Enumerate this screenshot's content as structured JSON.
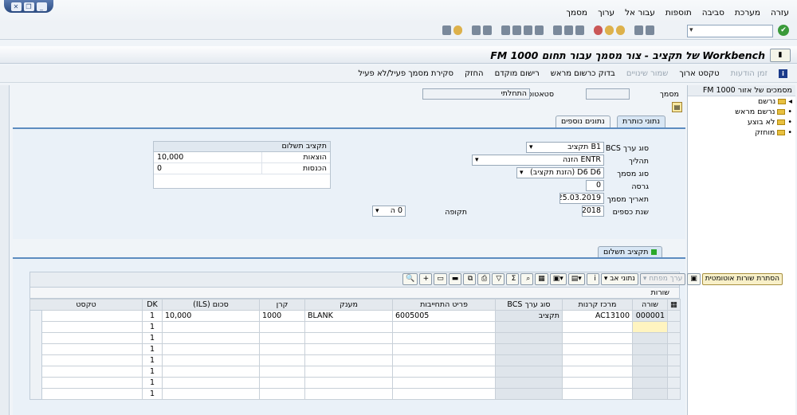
{
  "menu": [
    "מסמך",
    "ערוך",
    "עבור אל",
    "תוספות",
    "סביבה",
    "מערכת",
    "עזרה"
  ],
  "title": "Workbench של תקציב - צור מסמך עבור תחום FM 1000",
  "app_toolbar": {
    "toggle_doc": "סקירת מסמך פעיל/לא פעיל",
    "hold": "החזק",
    "post_prelim": "רישום מוקדם",
    "check_prelim": "בדוק כרשום מראש",
    "save_changes": "שמור שינויים",
    "long_text": "טקסט ארוך",
    "msg_time": "זמן הודעות"
  },
  "tree": {
    "header": "מסמכים של אזור FM 1000",
    "nodes": [
      "נרשם",
      "נרשם מראש",
      "לא בוצע",
      "מוחזק"
    ]
  },
  "header_fields": {
    "doc_label": "מסמך",
    "doc_value": "",
    "status_label": "סטאטוס",
    "status_value": "התחלתי"
  },
  "tabs": {
    "header_data": "נתוני כותרת",
    "additional": "נתונים נוספים"
  },
  "form": {
    "bcs_label": "סוג ערך BCS",
    "bcs_value": "B1 תקציב",
    "process_label": "תהליך",
    "process_value": "ENTR הזנה",
    "doctype_label": "סוג מסמך",
    "doctype_value": "D6 D6 (הזנת תקציב)",
    "version_label": "גרסה",
    "version_value": "0",
    "date_label": "תאריך מסמך",
    "date_value": "25.03.2019",
    "year_label": "שנת כספים",
    "year_value": "2018",
    "period_label": "תקופה",
    "period_value": "0 ה"
  },
  "budget_box": {
    "title": "תקציב תשלום",
    "rows": [
      {
        "label": "הוצאות",
        "value": "10,000"
      },
      {
        "label": "הכנסות",
        "value": "0"
      }
    ]
  },
  "lower_tab": "תקציב תשלום",
  "grid_toolbar": {
    "hide_auto": "הסתרת שורות אוטומטית",
    "key_value": "ערך מפתח",
    "parent_data": "נתוני אב"
  },
  "grid_caption": "שורות",
  "grid": {
    "headers": [
      "שורה",
      "מרכז קרנות",
      "סוג ערך BCS",
      "פריט התחייבות",
      "מענק",
      "קרן",
      "סכום (ILS)",
      "DK",
      "טקסט"
    ],
    "rows": [
      [
        "000001",
        "AC13100",
        "תקציב",
        "6005005",
        "BLANK",
        "1000",
        "10,000",
        "1",
        ""
      ],
      [
        "",
        "",
        "",
        "",
        "",
        "",
        "",
        "1",
        ""
      ],
      [
        "",
        "",
        "",
        "",
        "",
        "",
        "",
        "1",
        ""
      ],
      [
        "",
        "",
        "",
        "",
        "",
        "",
        "",
        "1",
        ""
      ],
      [
        "",
        "",
        "",
        "",
        "",
        "",
        "",
        "1",
        ""
      ],
      [
        "",
        "",
        "",
        "",
        "",
        "",
        "",
        "1",
        ""
      ],
      [
        "",
        "",
        "",
        "",
        "",
        "",
        "",
        "1",
        ""
      ],
      [
        "",
        "",
        "",
        "",
        "",
        "",
        "",
        "1",
        ""
      ]
    ]
  }
}
